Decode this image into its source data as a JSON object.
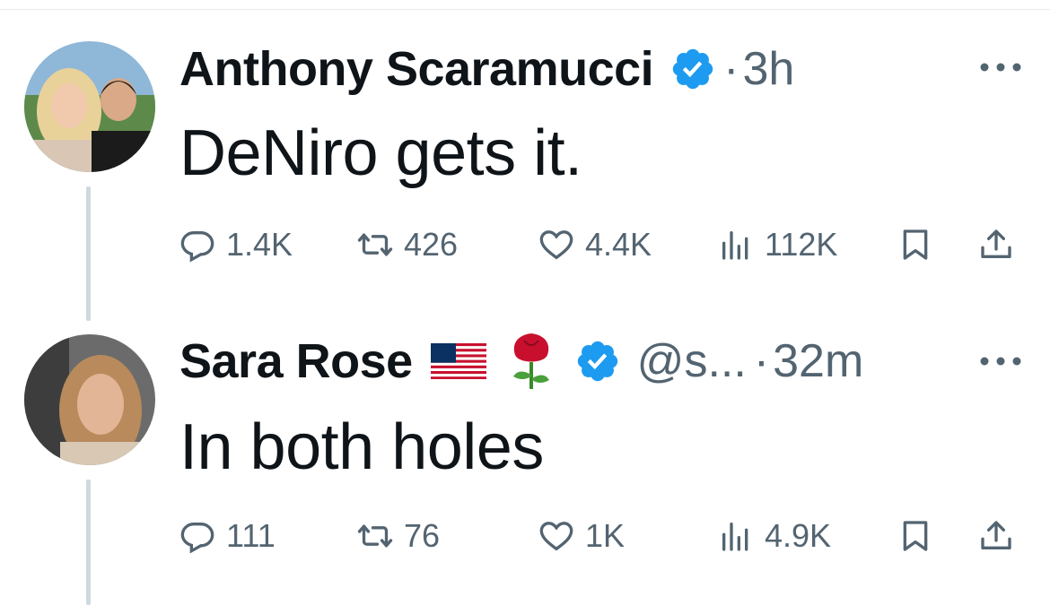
{
  "tweets": [
    {
      "author": "Anthony Scaramucci",
      "time": "3h",
      "text": "DeNiro gets it.",
      "replies": "1.4K",
      "retweets": "426",
      "likes": "4.4K",
      "views": "112K"
    },
    {
      "author": "Sara Rose",
      "handle": "@s...",
      "time": "32m",
      "text": "In both holes",
      "replies": "111",
      "retweets": "76",
      "likes": "1K",
      "views": "4.9K"
    }
  ],
  "colors": {
    "verified": "#1d9bf0",
    "secondary_text": "#536471",
    "thread_line": "#cfd9de"
  },
  "icons": [
    "verified-badge-icon",
    "more-icon",
    "reply-icon",
    "retweet-icon",
    "like-icon",
    "views-icon",
    "bookmark-icon",
    "share-icon",
    "us-flag-icon",
    "rose-icon"
  ]
}
